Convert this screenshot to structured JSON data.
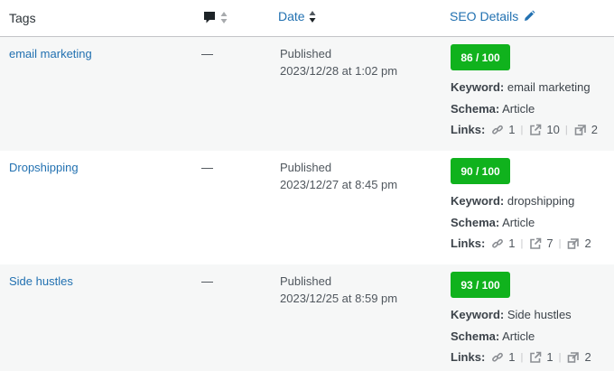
{
  "header": {
    "tags_label": "Tags",
    "comments_icon": "comment-icon",
    "date_label": "Date",
    "seo_label": "SEO Details"
  },
  "rows": [
    {
      "tag": "email marketing",
      "comments": "—",
      "status": "Published",
      "datetime": "2023/12/28 at 1:02 pm",
      "score": "86 / 100",
      "keyword_label": "Keyword:",
      "keyword": "email marketing",
      "schema_label": "Schema:",
      "schema": "Article",
      "links_label": "Links:",
      "internal": "1",
      "external": "10",
      "incoming": "2"
    },
    {
      "tag": "Dropshipping",
      "comments": "—",
      "status": "Published",
      "datetime": "2023/12/27 at 8:45 pm",
      "score": "90 / 100",
      "keyword_label": "Keyword:",
      "keyword": "dropshipping",
      "schema_label": "Schema:",
      "schema": "Article",
      "links_label": "Links:",
      "internal": "1",
      "external": "7",
      "incoming": "2"
    },
    {
      "tag": "Side hustles",
      "comments": "—",
      "status": "Published",
      "datetime": "2023/12/25 at 8:59 pm",
      "score": "93 / 100",
      "keyword_label": "Keyword:",
      "keyword": "Side hustles",
      "schema_label": "Schema:",
      "schema": "Article",
      "links_label": "Links:",
      "internal": "1",
      "external": "1",
      "incoming": "2"
    }
  ],
  "colors": {
    "link": "#2271b1",
    "score_green": "#10b21d",
    "row_alt": "#f6f7f7"
  }
}
